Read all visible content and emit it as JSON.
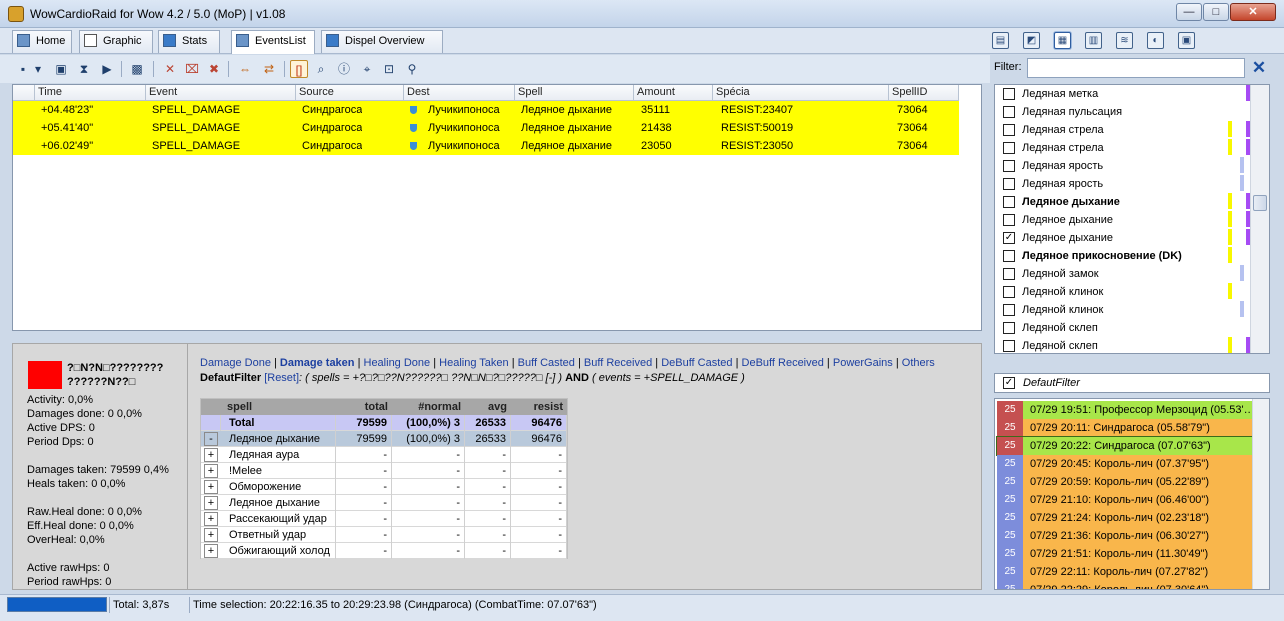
{
  "window": {
    "title": "WowCardioRaid for Wow 4.2 / 5.0 (MoP) | v1.08",
    "min": "—",
    "max": "□",
    "close": "✕"
  },
  "tabs": [
    {
      "label": "Home"
    },
    {
      "label": "Graphic"
    },
    {
      "label": "Stats"
    },
    {
      "label": "EventsList",
      "active": true
    },
    {
      "label": "Dispel Overview"
    }
  ],
  "filter": {
    "label": "Filter:",
    "value": "",
    "clear": "✕"
  },
  "grid": {
    "columns": [
      "Time",
      "Event",
      "Source",
      "Dest",
      "Spell",
      "Amount",
      "Spécia",
      "SpellID"
    ],
    "rows": [
      [
        "+04.48'23\"",
        "SPELL_DAMAGE",
        "Синдрагоса",
        "Лучикипоноса",
        "Ледяное дыхание",
        "35111",
        "RESIST:23407",
        "73064"
      ],
      [
        "+05.41'40\"",
        "SPELL_DAMAGE",
        "Синдрагоса",
        "Лучикипоноса",
        "Ледяное дыхание",
        "21438",
        "RESIST:50019",
        "73064"
      ],
      [
        "+06.02'49\"",
        "SPELL_DAMAGE",
        "Синдрагоса",
        "Лучикипоноса",
        "Ледяное дыхание",
        "23050",
        "RESIST:23050",
        "73064"
      ]
    ],
    "row_color": "#ffff00"
  },
  "spell_list": [
    {
      "label": "Ледяная метка",
      "checked": false,
      "bold": false,
      "marks": [
        "#a64bf4"
      ]
    },
    {
      "label": "Ледяная пульсация",
      "checked": false,
      "bold": false,
      "marks": []
    },
    {
      "label": "Ледяная стрела",
      "checked": false,
      "bold": false,
      "marks": [
        "#f8f800",
        "#a64bf4"
      ]
    },
    {
      "label": "Ледяная стрела",
      "checked": false,
      "bold": false,
      "marks": [
        "#f8f800",
        "#a64bf4"
      ]
    },
    {
      "label": "Ледяная ярость",
      "checked": false,
      "bold": false,
      "marks": [
        "#b6c2f0"
      ]
    },
    {
      "label": "Ледяная ярость",
      "checked": false,
      "bold": false,
      "marks": [
        "#b6c2f0"
      ]
    },
    {
      "label": "Ледяное дыхание",
      "checked": false,
      "bold": true,
      "marks": [
        "#f8f800",
        "#a64bf4"
      ]
    },
    {
      "label": "Ледяное дыхание",
      "checked": false,
      "bold": false,
      "marks": [
        "#f8f800",
        "#a64bf4"
      ]
    },
    {
      "label": "Ледяное дыхание",
      "checked": true,
      "bold": false,
      "marks": [
        "#f8f800",
        "#a64bf4"
      ]
    },
    {
      "label": "Ледяное прикосновение (DK)",
      "checked": false,
      "bold": true,
      "marks": [
        "#f8f800"
      ]
    },
    {
      "label": "Ледяной замок",
      "checked": false,
      "bold": false,
      "marks": [
        "#b6c2f0"
      ]
    },
    {
      "label": "Ледяной клинок",
      "checked": false,
      "bold": false,
      "marks": [
        "#f8f800"
      ]
    },
    {
      "label": "Ледяной клинок",
      "checked": false,
      "bold": false,
      "marks": [
        "#b6c2f0"
      ]
    },
    {
      "label": "Ледяной склеп",
      "checked": false,
      "bold": false,
      "marks": []
    },
    {
      "label": "Ледяной склеп",
      "checked": false,
      "bold": false,
      "marks": [
        "#f8f800",
        "#a64bf4"
      ]
    }
  ],
  "default_filter_label": "DefautFilter",
  "fights": [
    {
      "num": "25",
      "text": "07/29  19:51: Профессор Мерзоцид (05.53'…",
      "style": "green",
      "numstyle": "red"
    },
    {
      "num": "25",
      "text": "07/29  20:11: Синдрагоса (05.58'79\")",
      "style": "orange",
      "numstyle": "red"
    },
    {
      "num": "25",
      "text": "07/29  20:22: Синдрагоса (07.07'63\")",
      "style": "sel",
      "numstyle": "red"
    },
    {
      "num": "25",
      "text": "07/29  20:45: Король-лич (07.37'95\")",
      "style": "orange",
      "numstyle": "blue"
    },
    {
      "num": "25",
      "text": "07/29  20:59: Король-лич (05.22'89\")",
      "style": "orange",
      "numstyle": "blue"
    },
    {
      "num": "25",
      "text": "07/29  21:10: Король-лич (06.46'00\")",
      "style": "orange",
      "numstyle": "blue"
    },
    {
      "num": "25",
      "text": "07/29  21:24: Король-лич (02.23'18\")",
      "style": "orange",
      "numstyle": "blue"
    },
    {
      "num": "25",
      "text": "07/29  21:36: Король-лич (06.30'27\")",
      "style": "orange",
      "numstyle": "blue"
    },
    {
      "num": "25",
      "text": "07/29  21:51: Король-лич (11.30'49\")",
      "style": "orange",
      "numstyle": "blue"
    },
    {
      "num": "25",
      "text": "07/29  22:11: Король-лич (07.27'82\")",
      "style": "orange",
      "numstyle": "blue"
    },
    {
      "num": "25",
      "text": "07/29  22:29: Король-лич (07.30'64\")",
      "style": "orange",
      "numstyle": "blue"
    }
  ],
  "boss": {
    "color": "#ff0000",
    "name": "?□N?N□???????? ??????N??□"
  },
  "stats": {
    "activity": "Activity: 0,0%",
    "damages_done": "Damages done: 0 0,0%",
    "active_dps": "Active DPS: 0",
    "period_dps": "Period Dps: 0",
    "damages_taken": "Damages taken: 79599 0,4%",
    "heals_taken": "Heals taken: 0 0,0%",
    "raw_heal": "Raw.Heal done: 0 0,0%",
    "eff_heal": "Eff.Heal done: 0 0,0%",
    "overheal": "OverHeal: 0,0%",
    "active_rawhps": "Active rawHps: 0",
    "period_rawhps": "Period rawHps: 0"
  },
  "filter_links": [
    {
      "label": "Damage Done",
      "active": false
    },
    {
      "label": "Damage taken",
      "active": true
    },
    {
      "label": "Healing Done",
      "active": false
    },
    {
      "label": "Healing Taken",
      "active": false
    },
    {
      "label": "Buff Casted",
      "active": false
    },
    {
      "label": "Buff Received",
      "active": false
    },
    {
      "label": "DeBuff Casted",
      "active": false
    },
    {
      "label": "DeBuff Received",
      "active": false
    },
    {
      "label": "PowerGains",
      "active": false
    },
    {
      "label": "Others",
      "active": false
    }
  ],
  "default_filter_line": {
    "name": "DefautFilter",
    "reset": "[Reset]",
    "expr1": ": ( spells = +?□?□??N??????□ ??N□N□?□?????□ [-] )",
    "and": "AND",
    "expr2": "( events = +SPELL_DAMAGE )"
  },
  "spell_table": {
    "headers": [
      "spell",
      "total",
      "#normal",
      "avg",
      "resist"
    ],
    "total_row": {
      "toggle": "",
      "spell": "Total",
      "total": "79599",
      "normal_pct": "(100,0%)",
      "normal_n": "3",
      "avg": "26533",
      "resist": "96476"
    },
    "rows": [
      {
        "toggle": "-",
        "spell": "Ледяное дыхание",
        "total": "79599",
        "normal_pct": "(100,0%)",
        "normal_n": "3",
        "avg": "26533",
        "resist": "96476"
      },
      {
        "toggle": "+",
        "spell": "Ледяная аура",
        "total": "-",
        "normal_pct": "-",
        "normal_n": "",
        "avg": "-",
        "resist": "-"
      },
      {
        "toggle": "+",
        "spell": "!Melee",
        "total": "-",
        "normal_pct": "-",
        "normal_n": "",
        "avg": "-",
        "resist": "-"
      },
      {
        "toggle": "+",
        "spell": "Обморожение",
        "total": "-",
        "normal_pct": "-",
        "normal_n": "",
        "avg": "-",
        "resist": "-"
      },
      {
        "toggle": "+",
        "spell": "Ледяное дыхание",
        "total": "-",
        "normal_pct": "-",
        "normal_n": "",
        "avg": "-",
        "resist": "-"
      },
      {
        "toggle": "+",
        "spell": "Рассекающий удар",
        "total": "-",
        "normal_pct": "-",
        "normal_n": "",
        "avg": "-",
        "resist": "-"
      },
      {
        "toggle": "+",
        "spell": "Ответный удар",
        "total": "-",
        "normal_pct": "-",
        "normal_n": "",
        "avg": "-",
        "resist": "-"
      },
      {
        "toggle": "+",
        "spell": "Обжигающий холод",
        "total": "-",
        "normal_pct": "-",
        "normal_n": "",
        "avg": "-",
        "resist": "-"
      }
    ]
  },
  "status": {
    "progress": 1.0,
    "total": "Total: 3,87s",
    "time_selection": "Time selection: 20:22:16.35 to 20:29:23.98 (Синдрагоса)  (CombatTime: 07.07'63\")"
  }
}
